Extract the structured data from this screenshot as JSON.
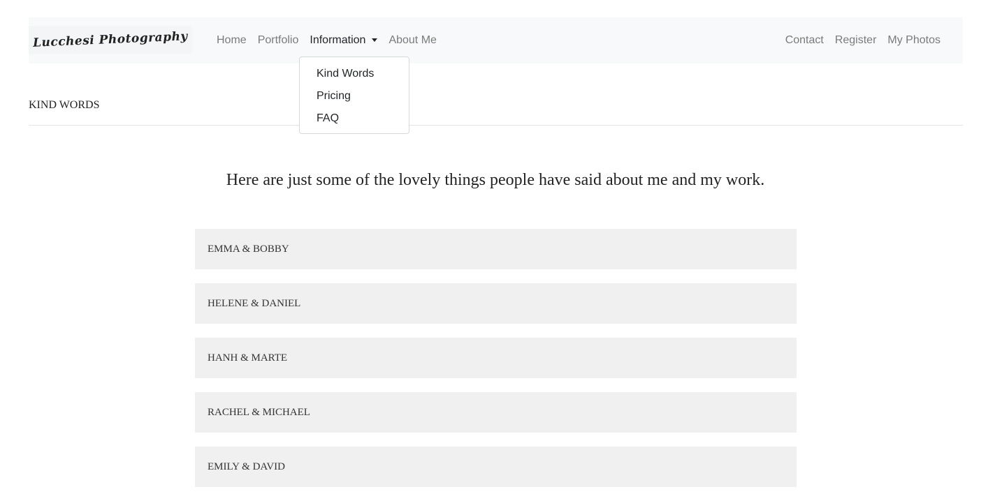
{
  "brand": {
    "name": "Lucchesi Photography"
  },
  "nav": {
    "left": [
      {
        "label": "Home"
      },
      {
        "label": "Portfolio"
      },
      {
        "label": "Information"
      },
      {
        "label": "About Me"
      }
    ],
    "right": [
      {
        "label": "Contact"
      },
      {
        "label": "Register"
      },
      {
        "label": "My Photos"
      }
    ]
  },
  "dropdown": {
    "items": [
      {
        "label": "Kind Words"
      },
      {
        "label": "Pricing"
      },
      {
        "label": "FAQ"
      }
    ]
  },
  "page": {
    "title": "KIND WORDS",
    "intro": "Here are just some of the lovely things people have said about me and my work."
  },
  "testimonials": [
    {
      "title": "EMMA & BOBBY"
    },
    {
      "title": "HELENE & DANIEL"
    },
    {
      "title": "HANH & MARTE"
    },
    {
      "title": "RACHEL & MICHAEL"
    },
    {
      "title": "EMILY & DAVID"
    }
  ],
  "colors": {
    "navbar_bg": "#f8f9fa",
    "nav_link": "#7a7a7a",
    "nav_link_active": "#212529",
    "card_bg": "#f0f0f0"
  },
  "icons": {
    "dropdown_caret": "caret-down-icon"
  }
}
